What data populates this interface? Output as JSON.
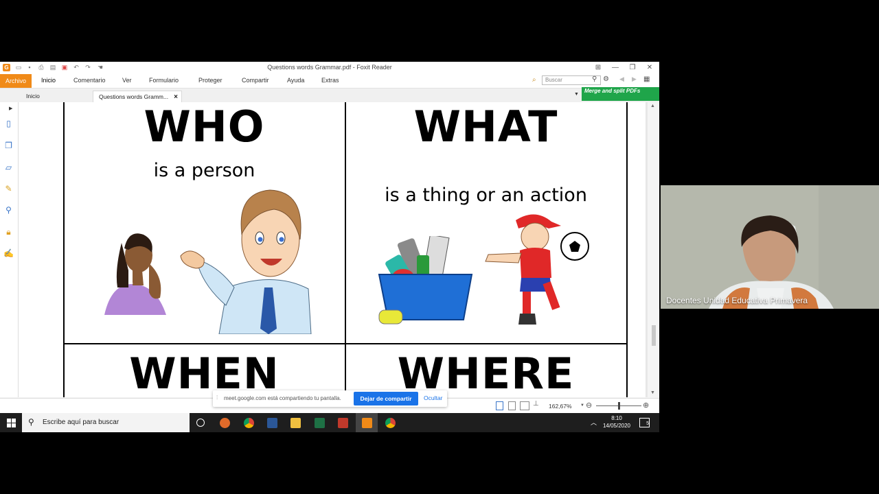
{
  "window": {
    "title": "Questions words Grammar.pdf - Foxit Reader",
    "menu": [
      "Archivo",
      "Inicio",
      "Comentario",
      "Ver",
      "Formulario",
      "Proteger",
      "Compartir",
      "Ayuda",
      "Extras"
    ],
    "search_placeholder": "Buscar",
    "tabs": [
      "Inicio",
      "Questions words Gramm..."
    ],
    "tab_close": "×",
    "promo": "Merge and split PDFs",
    "zoom": "162,67%"
  },
  "worksheet": {
    "cards": [
      {
        "title": "WHO",
        "subtitle": "is a person"
      },
      {
        "title": "WHAT",
        "subtitle": "is a thing or an action"
      },
      {
        "title": "WHEN",
        "subtitle": ""
      },
      {
        "title": "WHERE",
        "subtitle": ""
      }
    ]
  },
  "share_banner": {
    "text": "meet.google.com está compartiendo tu pantalla.",
    "stop_label": "Dejar de compartir",
    "hide_label": "Ocultar"
  },
  "taskbar": {
    "search_placeholder": "Escribe aquí para buscar",
    "time": "8:10",
    "date": "14/05/2020",
    "notifications": "5"
  },
  "meet": {
    "participant_name": "Docentes Unidad Educativa Primavera"
  },
  "colors": {
    "foxit_accent": "#f08a18",
    "promo_green": "#1fa54a",
    "meet_blue": "#1a73e8"
  }
}
